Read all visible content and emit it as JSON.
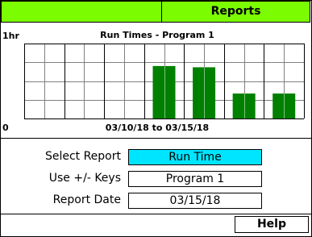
{
  "header": {
    "left_title": "",
    "right_title": "Reports"
  },
  "chart_data": {
    "type": "bar",
    "title": "Run Times - Program 1",
    "y_top_label": "1hr",
    "y_bottom_label": "0",
    "x_range_label": "03/10/18 to 03/15/18",
    "ylim": [
      0,
      60
    ],
    "bar_color": "#008000",
    "grid": true,
    "values": [
      0,
      0,
      0,
      42,
      41,
      20,
      20
    ]
  },
  "form": {
    "select_report_label": "Select Report",
    "select_report_value": "Run Time",
    "keys_label": "Use +/- Keys",
    "keys_value": "Program 1",
    "date_label": "Report Date",
    "date_value": "03/15/18"
  },
  "help": {
    "label": "Help"
  },
  "colors": {
    "header": "#7cfc00",
    "selected": "#00e5ff",
    "bar": "#008000"
  }
}
